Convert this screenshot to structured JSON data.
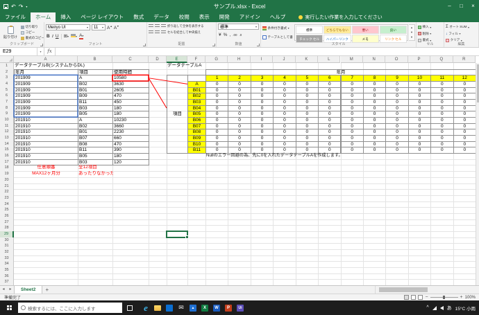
{
  "window": {
    "title": "サンプル.xlsx - Excel"
  },
  "ribbon": {
    "tabs": [
      "ファイル",
      "ホーム",
      "挿入",
      "ページ レイアウト",
      "数式",
      "データ",
      "校閲",
      "表示",
      "開発",
      "アドイン",
      "ヘルプ"
    ],
    "active_tab": "ホーム",
    "tell_me": "実行したい作業を入力してください",
    "clipboard": {
      "label": "クリップボード",
      "paste": "貼り付け",
      "cut": "切り取り",
      "copy": "コピー",
      "format_painter": "書式のコピー/貼り付け"
    },
    "font": {
      "label": "フォント",
      "name": "Meiryo UI",
      "size": "11",
      "bold": "B",
      "italic": "I",
      "underline": "U"
    },
    "alignment": {
      "label": "配置",
      "wrap": "折り返して全体を表示する",
      "merge": "セルを結合して中央揃え"
    },
    "number": {
      "label": "数値",
      "format": "標準"
    },
    "styles": {
      "label": "スタイル",
      "conditional": "条件付き書式",
      "format_table": "テーブルとして書式設定",
      "gallery": [
        {
          "name": "標準",
          "bg": "#FFFFFF",
          "fg": "#000000"
        },
        {
          "name": "どちらでもない",
          "bg": "#FFEB9C",
          "fg": "#9C6500"
        },
        {
          "name": "悪い",
          "bg": "#FFC7CE",
          "fg": "#9C0006"
        },
        {
          "name": "良い",
          "bg": "#C6EFCE",
          "fg": "#006100"
        },
        {
          "name": "チェック セル",
          "bg": "#A5A5A5",
          "fg": "#FFFFFF"
        },
        {
          "name": "ハイパーリンク",
          "bg": "#FFFFFF",
          "fg": "#0563C1"
        },
        {
          "name": "メモ",
          "bg": "#FFFFCC",
          "fg": "#000000"
        },
        {
          "name": "リンク セル",
          "bg": "#FFFFFF",
          "fg": "#FA7D00"
        }
      ]
    },
    "cells": {
      "label": "セル",
      "insert": "挿入",
      "delete": "削除",
      "format": "書式"
    },
    "editing": {
      "label": "編集",
      "autosum": "オート SUM",
      "fill": "フィル",
      "clear": "クリア"
    }
  },
  "formula_bar": {
    "name_box": "E29",
    "fx": "fx",
    "formula": ""
  },
  "grid": {
    "col_headers": [
      "A",
      "B",
      "C",
      "D",
      "E",
      "F",
      "G",
      "H",
      "I",
      "J",
      "K",
      "L",
      "M",
      "N",
      "O",
      "P",
      "Q",
      "R"
    ],
    "row_count": 37,
    "selected_cell": "E29",
    "table_b": {
      "title": "データテーブルB(システムからDL)",
      "headers": [
        "年月",
        "項目",
        "使用時間"
      ],
      "rows": [
        [
          "201909",
          "A",
          "10580"
        ],
        [
          "201909",
          "B02",
          "3630"
        ],
        [
          "201909",
          "B01",
          "2605"
        ],
        [
          "201909",
          "B09",
          "470"
        ],
        [
          "201909",
          "B11",
          "450"
        ],
        [
          "201909",
          "B03",
          "180"
        ],
        [
          "201909",
          "B05",
          "180"
        ],
        [
          "201910",
          "A",
          "10230"
        ],
        [
          "201910",
          "B02",
          "3660"
        ],
        [
          "201910",
          "B01",
          "2230"
        ],
        [
          "201910",
          "B07",
          "660"
        ],
        [
          "201910",
          "B08",
          "470"
        ],
        [
          "201910",
          "B11",
          "390"
        ],
        [
          "201910",
          "B05",
          "180"
        ],
        [
          "201910",
          "B03",
          "120"
        ]
      ],
      "notes": [
        [
          "任意順番",
          "全12項目"
        ],
        [
          "MAX12ヶ月分",
          "あったりなかったり"
        ]
      ]
    },
    "table_a": {
      "title": "データテーブルA",
      "col_axis_label": "年月",
      "row_axis_label": "項目",
      "months": [
        "1",
        "2",
        "3",
        "4",
        "5",
        "6",
        "7",
        "8",
        "9",
        "10",
        "11",
        "12"
      ],
      "items": [
        "A",
        "B01",
        "B02",
        "B03",
        "B04",
        "B05",
        "B06",
        "B07",
        "B08",
        "B09",
        "B10",
        "B11"
      ],
      "fill_value": "0",
      "note": "Nullのエラー回避の為、先に0を入れたデータテーブルAを作成します。"
    },
    "annotations": {
      "boxes": [
        {
          "range": "C3:C3",
          "color": "#FF0000"
        },
        {
          "range": "A3:A9",
          "color": "#4472C4"
        }
      ],
      "lines": [
        {
          "from": "C3",
          "to": "F4",
          "color": "#FF0000"
        },
        {
          "from": "C3",
          "to": "E8",
          "color": "#FF0000"
        }
      ]
    }
  },
  "sheet_bar": {
    "active_sheet": "Sheet2"
  },
  "status_bar": {
    "mode": "準備完了",
    "zoom": "100%"
  },
  "taskbar": {
    "search_placeholder": "検索するには、ここに入力します",
    "app_icons": [
      "edge",
      "file-explorer",
      "store",
      "mail",
      "photos",
      "excel",
      "word",
      "powerpoint",
      "uipath"
    ],
    "ime": "あ",
    "weather": "15°C 小雨"
  },
  "colors": {
    "excel_green": "#217346",
    "highlight_yellow": "#FFFF00",
    "annotation_red": "#FF0000",
    "annotation_blue": "#4472C4",
    "taskbar_dark": "#1D1D1D"
  }
}
